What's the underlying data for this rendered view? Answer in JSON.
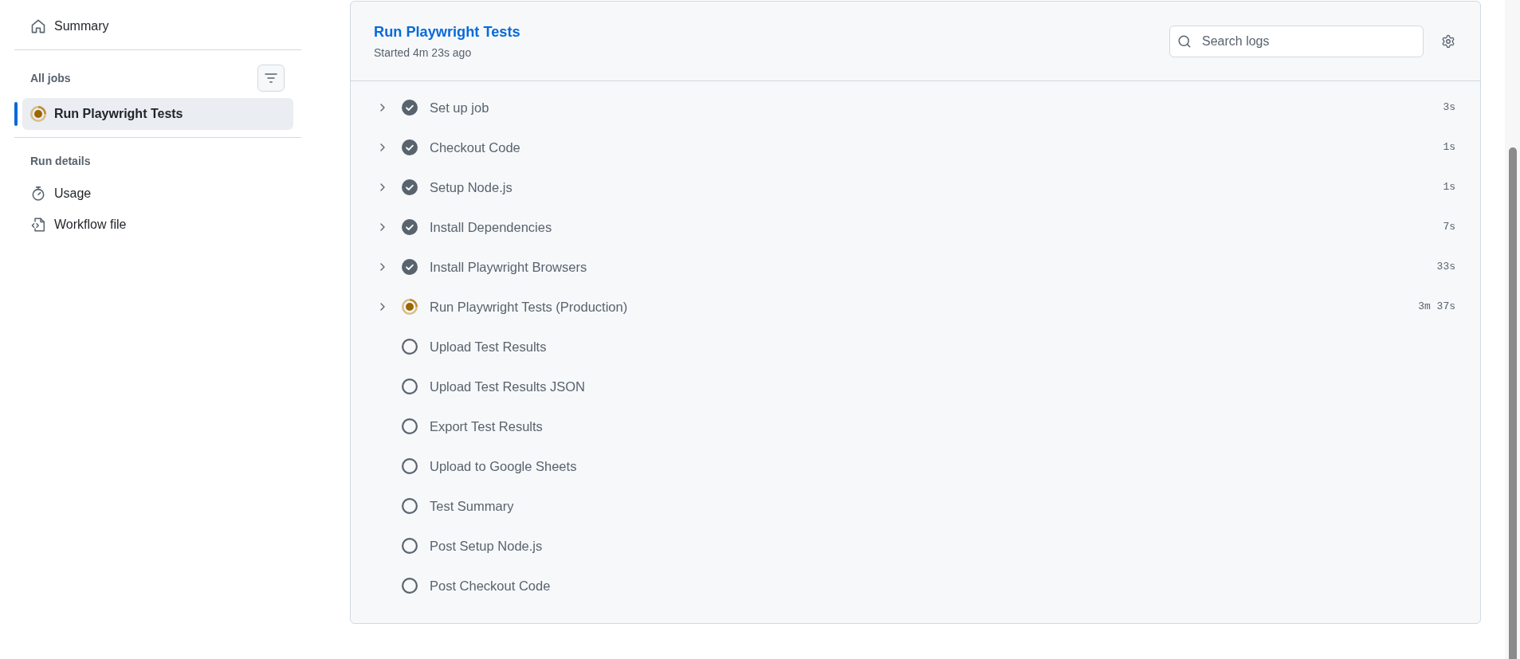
{
  "sidebar": {
    "summary": {
      "label": "Summary"
    },
    "all_jobs": {
      "heading": "All jobs",
      "jobs": [
        {
          "label": "Run Playwright Tests",
          "kind": "in_progress",
          "selected": true
        }
      ]
    },
    "run_details": {
      "heading": "Run details",
      "usage": {
        "label": "Usage"
      },
      "workflow_file": {
        "label": "Workflow file"
      }
    }
  },
  "job": {
    "title": "Run Playwright Tests",
    "started": "Started 4m 23s ago",
    "search": {
      "placeholder": "Search logs"
    },
    "steps": [
      {
        "name": "Set up job",
        "kind": "success",
        "expandable": true,
        "duration": "3s"
      },
      {
        "name": "Checkout Code",
        "kind": "success",
        "expandable": true,
        "duration": "1s"
      },
      {
        "name": "Setup Node.js",
        "kind": "success",
        "expandable": true,
        "duration": "1s"
      },
      {
        "name": "Install Dependencies",
        "kind": "success",
        "expandable": true,
        "duration": "7s"
      },
      {
        "name": "Install Playwright Browsers",
        "kind": "success",
        "expandable": true,
        "duration": "33s"
      },
      {
        "name": "Run Playwright Tests (Production)",
        "kind": "in_progress",
        "expandable": true,
        "duration": "3m 37s"
      },
      {
        "name": "Upload Test Results",
        "kind": "pending",
        "expandable": false
      },
      {
        "name": "Upload Test Results JSON",
        "kind": "pending",
        "expandable": false
      },
      {
        "name": "Export Test Results",
        "kind": "pending",
        "expandable": false
      },
      {
        "name": "Upload to Google Sheets",
        "kind": "pending",
        "expandable": false
      },
      {
        "name": "Test Summary",
        "kind": "pending",
        "expandable": false
      },
      {
        "name": "Post Setup Node.js",
        "kind": "pending",
        "expandable": false
      },
      {
        "name": "Post Checkout Code",
        "kind": "pending",
        "expandable": false
      }
    ]
  }
}
